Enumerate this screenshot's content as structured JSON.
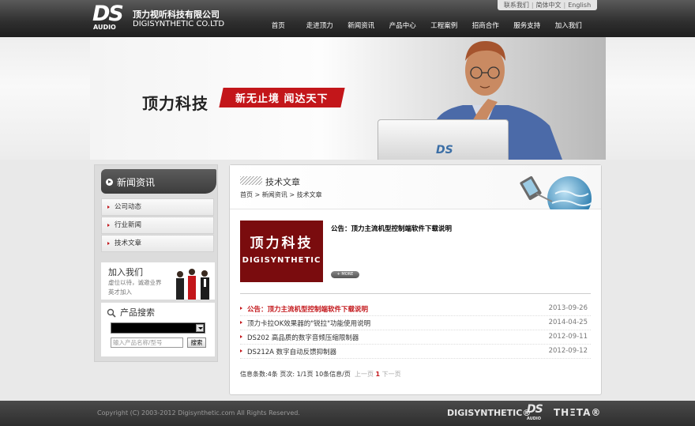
{
  "header": {
    "logo_ds": "DS",
    "logo_audio": "AUDIO",
    "company_cn": "顶力视听科技有限公司",
    "company_en": "DIGISYNTHETIC CO.LTD",
    "lang_links": [
      "联系我们",
      "简体中文",
      "English"
    ],
    "nav": [
      "首页",
      "走进顶力",
      "新闻资讯",
      "产品中心",
      "工程案例",
      "招商合作",
      "服务支持",
      "加入我们"
    ]
  },
  "banner": {
    "slogan_main": "顶力科技",
    "slogan_tag": "新无止境  闻达天下",
    "laptop_logo": "DS"
  },
  "sidebar": {
    "title": "新闻资讯",
    "items": [
      "公司动态",
      "行业新闻",
      "技术文章"
    ],
    "join": {
      "title": "加入我们",
      "sub1": "虚位以待，诚邀业界",
      "sub2": "英才加入"
    },
    "search": {
      "title": "产品搜索",
      "placeholder": "输入产品名称/型号",
      "button": "搜索"
    }
  },
  "main": {
    "title": "技术文章",
    "breadcrumb": "首页 > 新闻资讯 > 技术文章",
    "feature": {
      "img_cn": "顶力科技",
      "img_en": "DIGISYNTHETIC",
      "title": "公告：顶力主流机型控制端软件下载说明",
      "more": "+ MORE"
    },
    "list": [
      {
        "title": "公告：顶力主流机型控制端软件下载说明",
        "date": "2013-09-26",
        "highlight": true
      },
      {
        "title": "顶力卡拉OK效果器的\"锐拉\"功能使用说明",
        "date": "2014-04-25",
        "highlight": false
      },
      {
        "title": "DS202 高品质的数字音频压缩限制器",
        "date": "2012-09-11",
        "highlight": false
      },
      {
        "title": "DS212A 数字自动反馈抑制器",
        "date": "2012-09-12",
        "highlight": false
      }
    ],
    "pagination": {
      "info": "信息条数:4条  页次: 1/1页  10条信息/页",
      "prev": "上一页",
      "current": "1",
      "next": "下一页"
    }
  },
  "footer": {
    "copyright": "Copyright (C) 2003-2012 Digisynthetic.com All Rights Reserved.",
    "brand_digi": "DIGISYNTHETIC®",
    "brand_ds": "DS",
    "brand_audio": "AUDIO",
    "brand_theta": "THΞTA®"
  },
  "colors": {
    "accent_red": "#c3161a",
    "header_dark": "#2e2e2e"
  }
}
